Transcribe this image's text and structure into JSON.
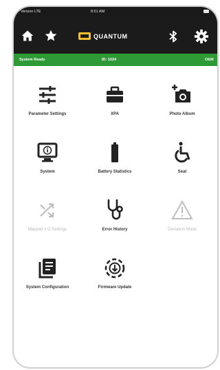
{
  "status_bar": {
    "carrier": "Verizon LTE",
    "time": "8:51 AM"
  },
  "nav": {
    "logo_text": "QUANTUM"
  },
  "banner": {
    "status": "System Ready",
    "id": "ID: 1024",
    "right": "OEM"
  },
  "tiles": [
    {
      "label": "Parameter Settings",
      "icon": "sliders-icon",
      "enabled": true
    },
    {
      "label": "XPA",
      "icon": "briefcase-icon",
      "enabled": true
    },
    {
      "label": "Photo Album",
      "icon": "camera-add-icon",
      "enabled": true
    },
    {
      "label": "System",
      "icon": "monitor-info-icon",
      "enabled": true
    },
    {
      "label": "Battery Statistics",
      "icon": "battery-icon",
      "enabled": true
    },
    {
      "label": "Seat",
      "icon": "wheelchair-icon",
      "enabled": true
    },
    {
      "label": "Mapped I/ O Settings",
      "icon": "shuffle-icon",
      "enabled": false
    },
    {
      "label": "Error History",
      "icon": "stethoscope-icon",
      "enabled": true
    },
    {
      "label": "Deviation Mode",
      "icon": "warning-icon",
      "enabled": false
    },
    {
      "label": "System Configuration",
      "icon": "documents-icon",
      "enabled": true
    },
    {
      "label": "Firmware Update",
      "icon": "download-cycle-icon",
      "enabled": true
    }
  ],
  "colors": {
    "green": "#2e9a35",
    "dark": "#1b1b1b",
    "accent": "#f2c12e"
  }
}
